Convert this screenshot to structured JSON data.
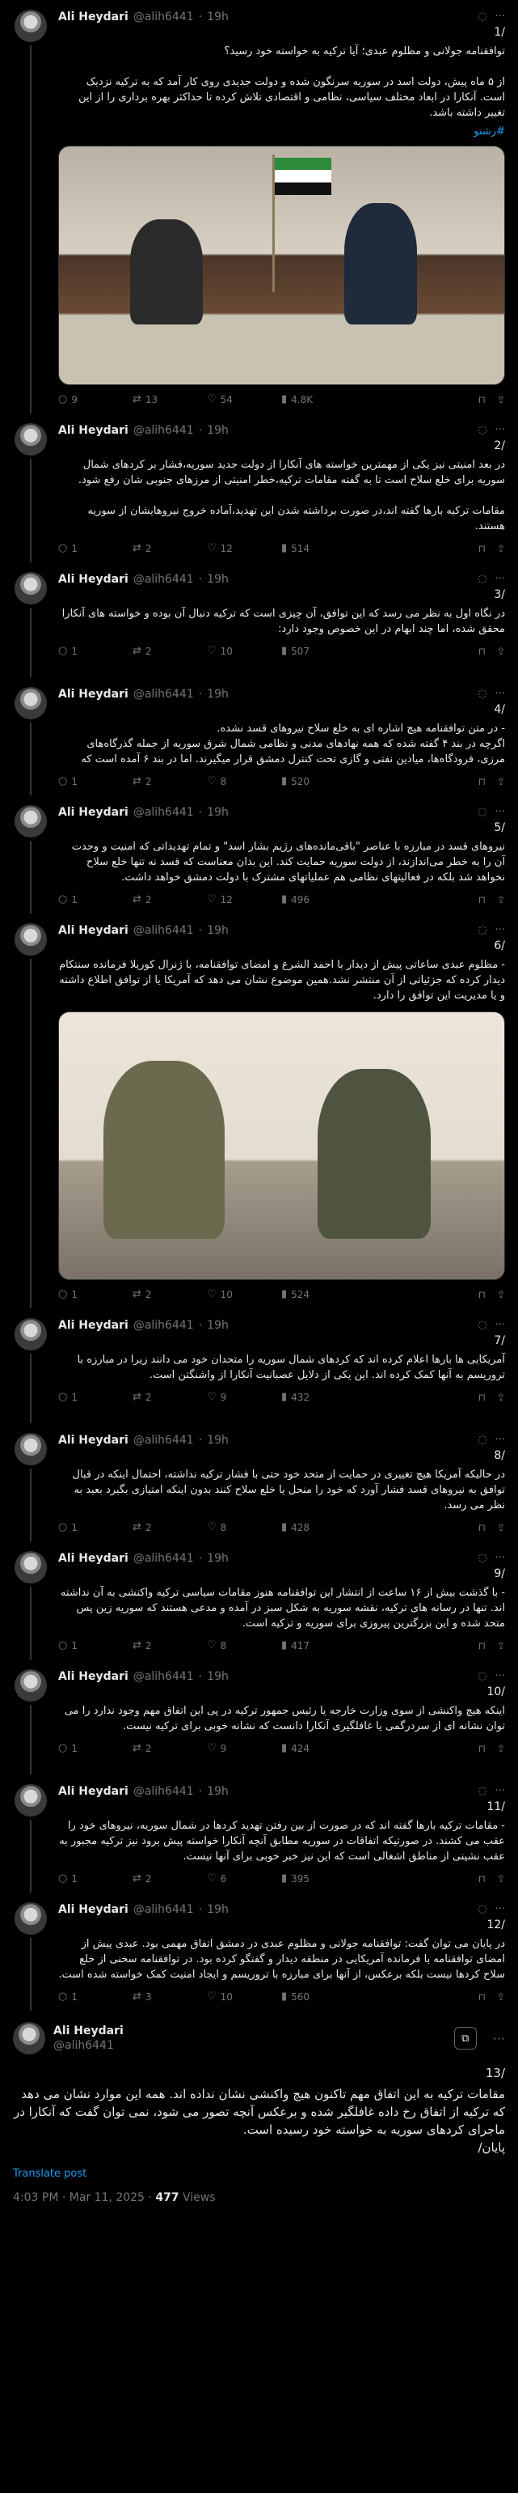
{
  "author": {
    "name": "Ali Heydari",
    "handle": "@alih6441",
    "dot": "·"
  },
  "tweets": [
    {
      "time": "19h",
      "num": "1/",
      "text": "توافقنامه جولانی و مظلوم عبدی؛ آیا ترکیه به خواسته خود رسید؟\n\nاز ۵ ماه پیش، دولت اسد در سوریه سرنگون شده و دولت جدیدی روی کار آمد که به ترکیه نزدیک است. آنکارا در ابعاد مختلف سیاسی، نظامی و اقتصادی تلاش کرده تا حداکثر بهره برداری را از این تغییر داشته باشد.",
      "hashtag": "#رشنو",
      "replies": "9",
      "reposts": "13",
      "likes": "54",
      "views": "4.8K"
    },
    {
      "time": "19h",
      "num": "2/",
      "text": "در بعد امنیتی نیز یکی از مهمترین خواسته های آنکارا از دولت جدید سوریه،فشار بر کردهای شمال سوریه برای خلع سلاح است تا به گفته مقامات ترکیه،خطر امنیتی از مرزهای جنوبی شان رفع شود.\n\nمقامات ترکیه بارها گفته اند،در صورت برداشته شدن این تهدید،آماده خروج نیروهایشان از سوریه هستند.",
      "replies": "1",
      "reposts": "2",
      "likes": "12",
      "views": "514"
    },
    {
      "time": "19h",
      "num": "3/",
      "text": "در نگاه اول به نظر می رسد که این توافق، آن چیزی است که ترکیه دنبال آن بوده و خواسته های آنکارا محقق شده، اما چند ابهام در این خصوص وجود دارد:",
      "replies": "1",
      "reposts": "2",
      "likes": "10",
      "views": "507"
    },
    {
      "time": "19h",
      "num": "4/",
      "text": "- در متن توافقنامه هیچ اشاره ای به خلع سلاح نیروهای قسد نشده.\nاگرچه در بند ۴ گفته شده که همه نهادهای مدنی و نظامی شمال شرق سوریه از جمله گذرگاه‌های مرزی، فرودگاه‌ها، میادین نفتی و گازی تحت کنترل دمشق قرار میگیرند. اما در بند ۶ آمده است که",
      "replies": "1",
      "reposts": "2",
      "likes": "8",
      "views": "520"
    },
    {
      "time": "19h",
      "num": "5/",
      "text": "نیروهای قسد در مبارزه با عناصر \"باقی‌مانده‌های رژیم بشار اسد\" و تمام تهدیداتی که امنیت و وحدت آن را به خطر می‌اندازند، از دولت سوریه حمایت کند. این بدان معناست که قسد نه تنها خلع سلاح نخواهد شد بلکه در فعالیتهای نظامی هم عملیاتهای مشترک با دولت دمشق خواهد داشت.",
      "replies": "1",
      "reposts": "2",
      "likes": "12",
      "views": "496"
    },
    {
      "time": "19h",
      "num": "6/",
      "text": "- مظلوم عبدی ساعاتی پیش از دیدار با احمد الشرع و امضای توافقنامه، با ژنرال کوریلا فرمانده سنتکام دیدار کرده که جزئیاتی از آن منتشر نشد.همین موضوع نشان می دهد که آمریکا یا از توافق اطلاع داشته و یا مدیریت این توافق را دارد.",
      "replies": "1",
      "reposts": "2",
      "likes": "10",
      "views": "524"
    },
    {
      "time": "19h",
      "num": "7/",
      "text": "آمریکایی ها بارها اعلام کرده اند که کردهای شمال سوریه را متحدان خود می دانند زیرا در مبارزه با تروریسم به آنها کمک کرده اند. این یکی از دلایل عصبانیت آنکارا از واشنگتن است.",
      "replies": "1",
      "reposts": "2",
      "likes": "9",
      "views": "432"
    },
    {
      "time": "19h",
      "num": "8/",
      "text": "در حالیکه آمریکا هیچ تغییری در حمایت از متحد خود حتی با فشار ترکیه نداشته، احتمال اینکه در قبال توافق به نیروهای قسد فشار آورد که خود را منحل یا خلع سلاح کنند بدون اینکه امتیازی بگیرد بعید به نظر می رسد.",
      "replies": "1",
      "reposts": "2",
      "likes": "8",
      "views": "428"
    },
    {
      "time": "19h",
      "num": "9/",
      "text": "- با گذشت بیش از ۱۶ ساعت از انتشار این توافقنامه هنوز مقامات سیاسی ترکیه واکنشی به آن نداشته اند. تنها در رسانه های ترکیه، نقشه سوریه به شکل سبز در آمده و مدعی هستند که سوریه زین پس متحد شده و این بزرگترین پیروزی برای سوریه و ترکیه است.",
      "replies": "1",
      "reposts": "2",
      "likes": "8",
      "views": "417"
    },
    {
      "time": "19h",
      "num": "10/",
      "text": "اینکه هیچ واکنشی از سوی وزارت خارجه یا رئیس جمهور ترکیه در پی این اتفاق مهم وجود ندارد را می توان نشانه ای از سردرگمی یا غافلگیری آنکارا دانست که نشانه خوبی برای ترکیه نیست.",
      "replies": "1",
      "reposts": "2",
      "likes": "9",
      "views": "424"
    },
    {
      "time": "19h",
      "num": "11/",
      "text": "- مقامات ترکیه بارها گفته اند که در صورت از بین رفتن تهدید کردها در شمال سوریه، نیروهای خود را عقب می کشند. در صورتیکه اتفاقات در سوریه مطابق آنچه آنکارا خواسته پیش برود نیز ترکیه مجبور به عقب نشینی از مناطق اشغالی است که این نیز خبر خوبی برای آنها نیست.",
      "replies": "1",
      "reposts": "2",
      "likes": "6",
      "views": "395"
    },
    {
      "time": "19h",
      "num": "12/",
      "text": "در پایان می توان گفت: توافقنامه جولانی و مظلوم عبدی در دمشق اتفاق مهمی بود. عبدی پیش از امضای توافقنامه با فرمانده آمریکایی در منطقه دیدار و گفتگو کرده بود. در توافقنامه سخنی از خلع سلاح کردها نیست بلکه برعکس، از آنها برای مبارزه با تروریسم و ایجاد امنیت کمک خواسته شده است.",
      "replies": "1",
      "reposts": "3",
      "likes": "10",
      "views": "560"
    }
  ],
  "main": {
    "num": "13/",
    "text": "مقامات ترکیه به این اتفاق مهم تاکنون هیچ واکنشی نشان نداده اند. همه این موارد نشان می دهد که ترکیه از اتفاق رخ داده غافلگیر شده و برعکس آنچه تصور می شود، نمی توان گفت که آنکارا در ماجرای کردهای سوریه به خواسته خود رسیده است.\nپایان/",
    "translate": "Translate post",
    "time": "4:03 PM · Mar 11, 2025 ·",
    "views_count": "477",
    "views_label": "Views"
  },
  "icons": {
    "reply": "reply-icon",
    "repost": "repost-icon",
    "like": "heart-icon",
    "views": "views-icon",
    "bookmark": "bookmark-icon",
    "share": "share-icon"
  }
}
